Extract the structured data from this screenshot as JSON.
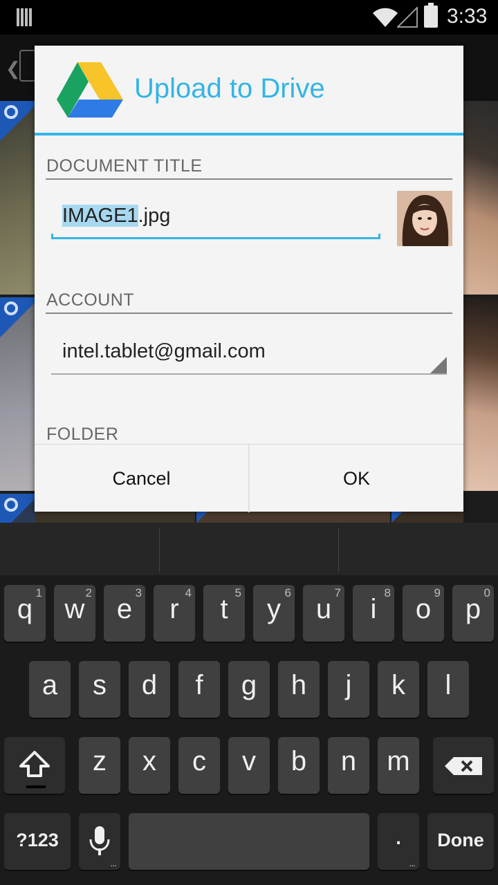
{
  "status_bar": {
    "time": "3:33",
    "icons": [
      "notification-icon",
      "wifi-icon",
      "signal-icon",
      "battery-icon"
    ]
  },
  "dialog": {
    "title": "Upload to Drive",
    "accent_color": "#33b5e5",
    "document_title_label": "DOCUMENT TITLE",
    "document_title": {
      "selected": "IMAGE1",
      "rest": ".jpg"
    },
    "account_label": "ACCOUNT",
    "account_value": "intel.tablet@gmail.com",
    "folder_label": "FOLDER",
    "cancel_label": "Cancel",
    "ok_label": "OK"
  },
  "keyboard": {
    "row1": [
      {
        "key": "q",
        "hint": "1"
      },
      {
        "key": "w",
        "hint": "2"
      },
      {
        "key": "e",
        "hint": "3"
      },
      {
        "key": "r",
        "hint": "4"
      },
      {
        "key": "t",
        "hint": "5"
      },
      {
        "key": "y",
        "hint": "6"
      },
      {
        "key": "u",
        "hint": "7"
      },
      {
        "key": "i",
        "hint": "8"
      },
      {
        "key": "o",
        "hint": "9"
      },
      {
        "key": "p",
        "hint": "0"
      }
    ],
    "row2": [
      "a",
      "s",
      "d",
      "f",
      "g",
      "h",
      "j",
      "k",
      "l"
    ],
    "row3": [
      "z",
      "x",
      "c",
      "v",
      "b",
      "n",
      "m"
    ],
    "symbols_label": "?123",
    "period_label": ".",
    "done_label": "Done",
    "more_dots": "..."
  }
}
